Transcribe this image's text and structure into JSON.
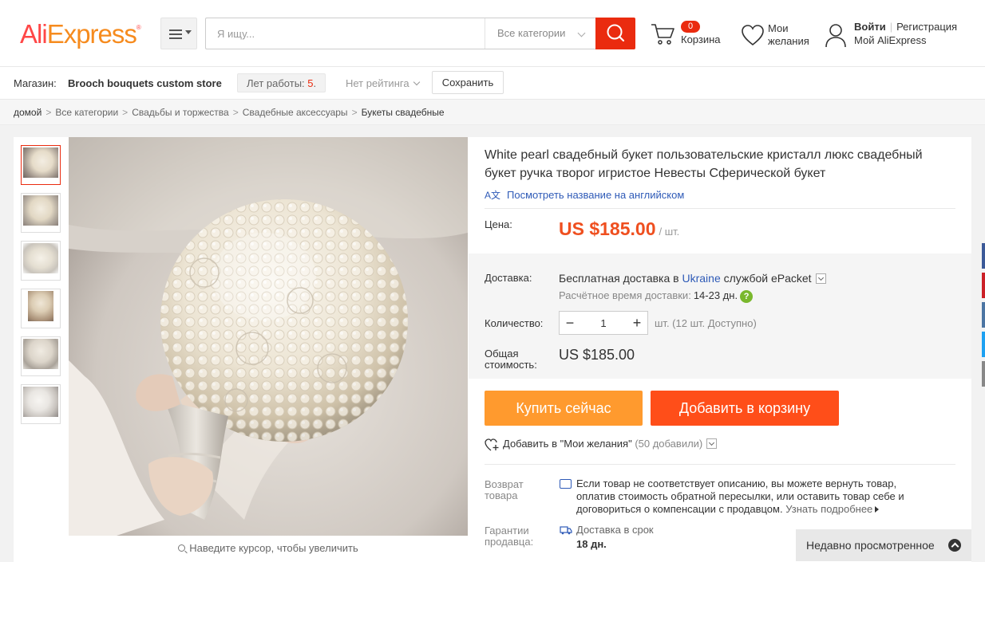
{
  "header": {
    "logo": {
      "ali": "Ali",
      "express": "Express",
      "tm": "®"
    },
    "search": {
      "placeholder": "Я ищу...",
      "category": "Все категории"
    },
    "cart": {
      "count": "0",
      "label": "Корзина"
    },
    "wishlist": {
      "line1": "Мои",
      "line2": "желания"
    },
    "account": {
      "login": "Войти",
      "register": "Регистрация",
      "my": "Мой AliExpress"
    }
  },
  "store": {
    "label": "Магазин:",
    "name": "Brooch bouquets custom store",
    "years_label": "Лет работы:",
    "years_value": "5",
    "years_suffix": ".",
    "rating": "Нет рейтинга",
    "save": "Сохранить"
  },
  "breadcrumb": {
    "items": [
      "домой",
      "Все категории",
      "Свадьбы и торжества",
      "Свадебные аксессуары"
    ],
    "current": "Букеты свадебные",
    "separator": ">"
  },
  "gallery": {
    "zoom_hint": "Наведите курсор, чтобы увеличить"
  },
  "product": {
    "title": "White pearl свадебный букет пользовательские кристалл люкс свадебный букет ручка творог игристое Невесты Сферической букет",
    "translate_link": "Посмотреть название на английском",
    "price_label": "Цена:",
    "price": "US $185.00",
    "price_unit": "/ шт.",
    "shipping_label": "Доставка:",
    "shipping_pre": "Бесплатная доставка в ",
    "shipping_country": "Ukraine",
    "shipping_post": " службой ePacket",
    "delivery_time_label": "Расчётное время доставки:",
    "delivery_time_value": "14-23 дн.",
    "qty_label": "Количество:",
    "qty_value": "1",
    "qty_info": "шт. (12 шт. Доступно)",
    "total_label_1": "Общая",
    "total_label_2": "стоимость:",
    "total": "US $185.00",
    "buy_now": "Купить сейчас",
    "add_to_cart": "Добавить в корзину",
    "add_wish": "Добавить в \"Мои желания\"",
    "wish_count": "(50 добавили)",
    "return_label_1": "Возврат",
    "return_label_2": "товара",
    "return_text": "Если товар не соответствует описанию, вы можете вернуть товар, оплатив стоимость обратной пересылки, или оставить товар себе и договориться о компенсации с продавцом.",
    "return_more": "Узнать подробнее",
    "guarantee_label_1": "Гарантии",
    "guarantee_label_2": "продавца:",
    "guarantee_1": "Доставка в срок",
    "guarantee_2": "18 дн."
  },
  "recent": {
    "label": "Недавно просмотренное"
  },
  "colors": {
    "accent": "#ea2b0f",
    "buy": "#ff9a2e",
    "cart": "#ff4e19",
    "price": "#ef4f1f",
    "link": "#2e5ab7"
  }
}
